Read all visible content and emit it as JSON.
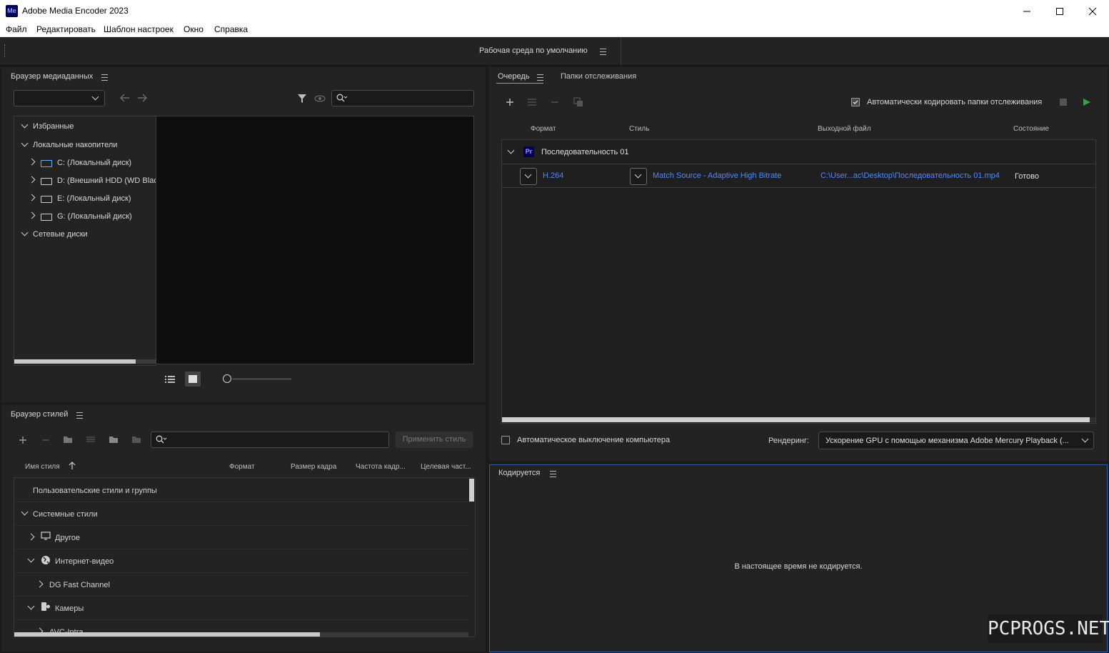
{
  "window": {
    "app_icon_text": "Me",
    "title": "Adobe Media Encoder 2023"
  },
  "menu": {
    "items": [
      "Файл",
      "Редактировать",
      "Шаблон настроек",
      "Окно",
      "Справка"
    ]
  },
  "workspace": {
    "label": "Рабочая среда по умолчанию"
  },
  "media_browser": {
    "title": "Браузер медиаданных",
    "tree": {
      "favorites": "Избранные",
      "local": "Локальные накопители",
      "drives": [
        "C: (Локальный диск)",
        "D: (Внешний HDD (WD Black",
        "E: (Локальный диск)",
        "G: (Локальный диск)"
      ],
      "network": "Сетевые диски"
    }
  },
  "style_browser": {
    "title": "Браузер стилей",
    "apply_label": "Применить стиль",
    "columns": [
      "Имя стиля",
      "Формат",
      "Размер кадра",
      "Частота кадр...",
      "Целевая част..."
    ],
    "rows": {
      "user": "Пользовательские стили и группы",
      "system": "Системные стили",
      "other": "Другое",
      "web": "Интернет-видео",
      "dg": "DG Fast Channel",
      "cameras": "Камеры",
      "avc": "AVC-Intra"
    }
  },
  "queue": {
    "tab_queue": "Очередь",
    "tab_watch": "Папки отслеживания",
    "auto_encode_label": "Автоматически кодировать папки отслеживания",
    "columns": {
      "format": "Формат",
      "style": "Стиль",
      "output": "Выходной файл",
      "status": "Состояние"
    },
    "sequence": {
      "icon_text": "Pr",
      "name": "Последовательность 01"
    },
    "item": {
      "format": "H.264",
      "style": "Match Source - Adaptive High Bitrate",
      "output": "C:\\User...ac\\Desktop\\Последовательность 01.mp4",
      "status": "Готово"
    },
    "shutdown_label": "Автоматическое выключение компьютера",
    "render_label": "Рендеринг:",
    "render_value": "Ускорение GPU с помощью механизма Adobe Mercury Playback (..."
  },
  "encoding": {
    "title": "Кодируется",
    "empty_text": "В настоящее время не кодируется."
  },
  "watermark": "PCPROGS.NET",
  "colors": {
    "accent_link": "#4a8bff",
    "play_green": "#2fa83a",
    "panel_bg": "#232323"
  }
}
